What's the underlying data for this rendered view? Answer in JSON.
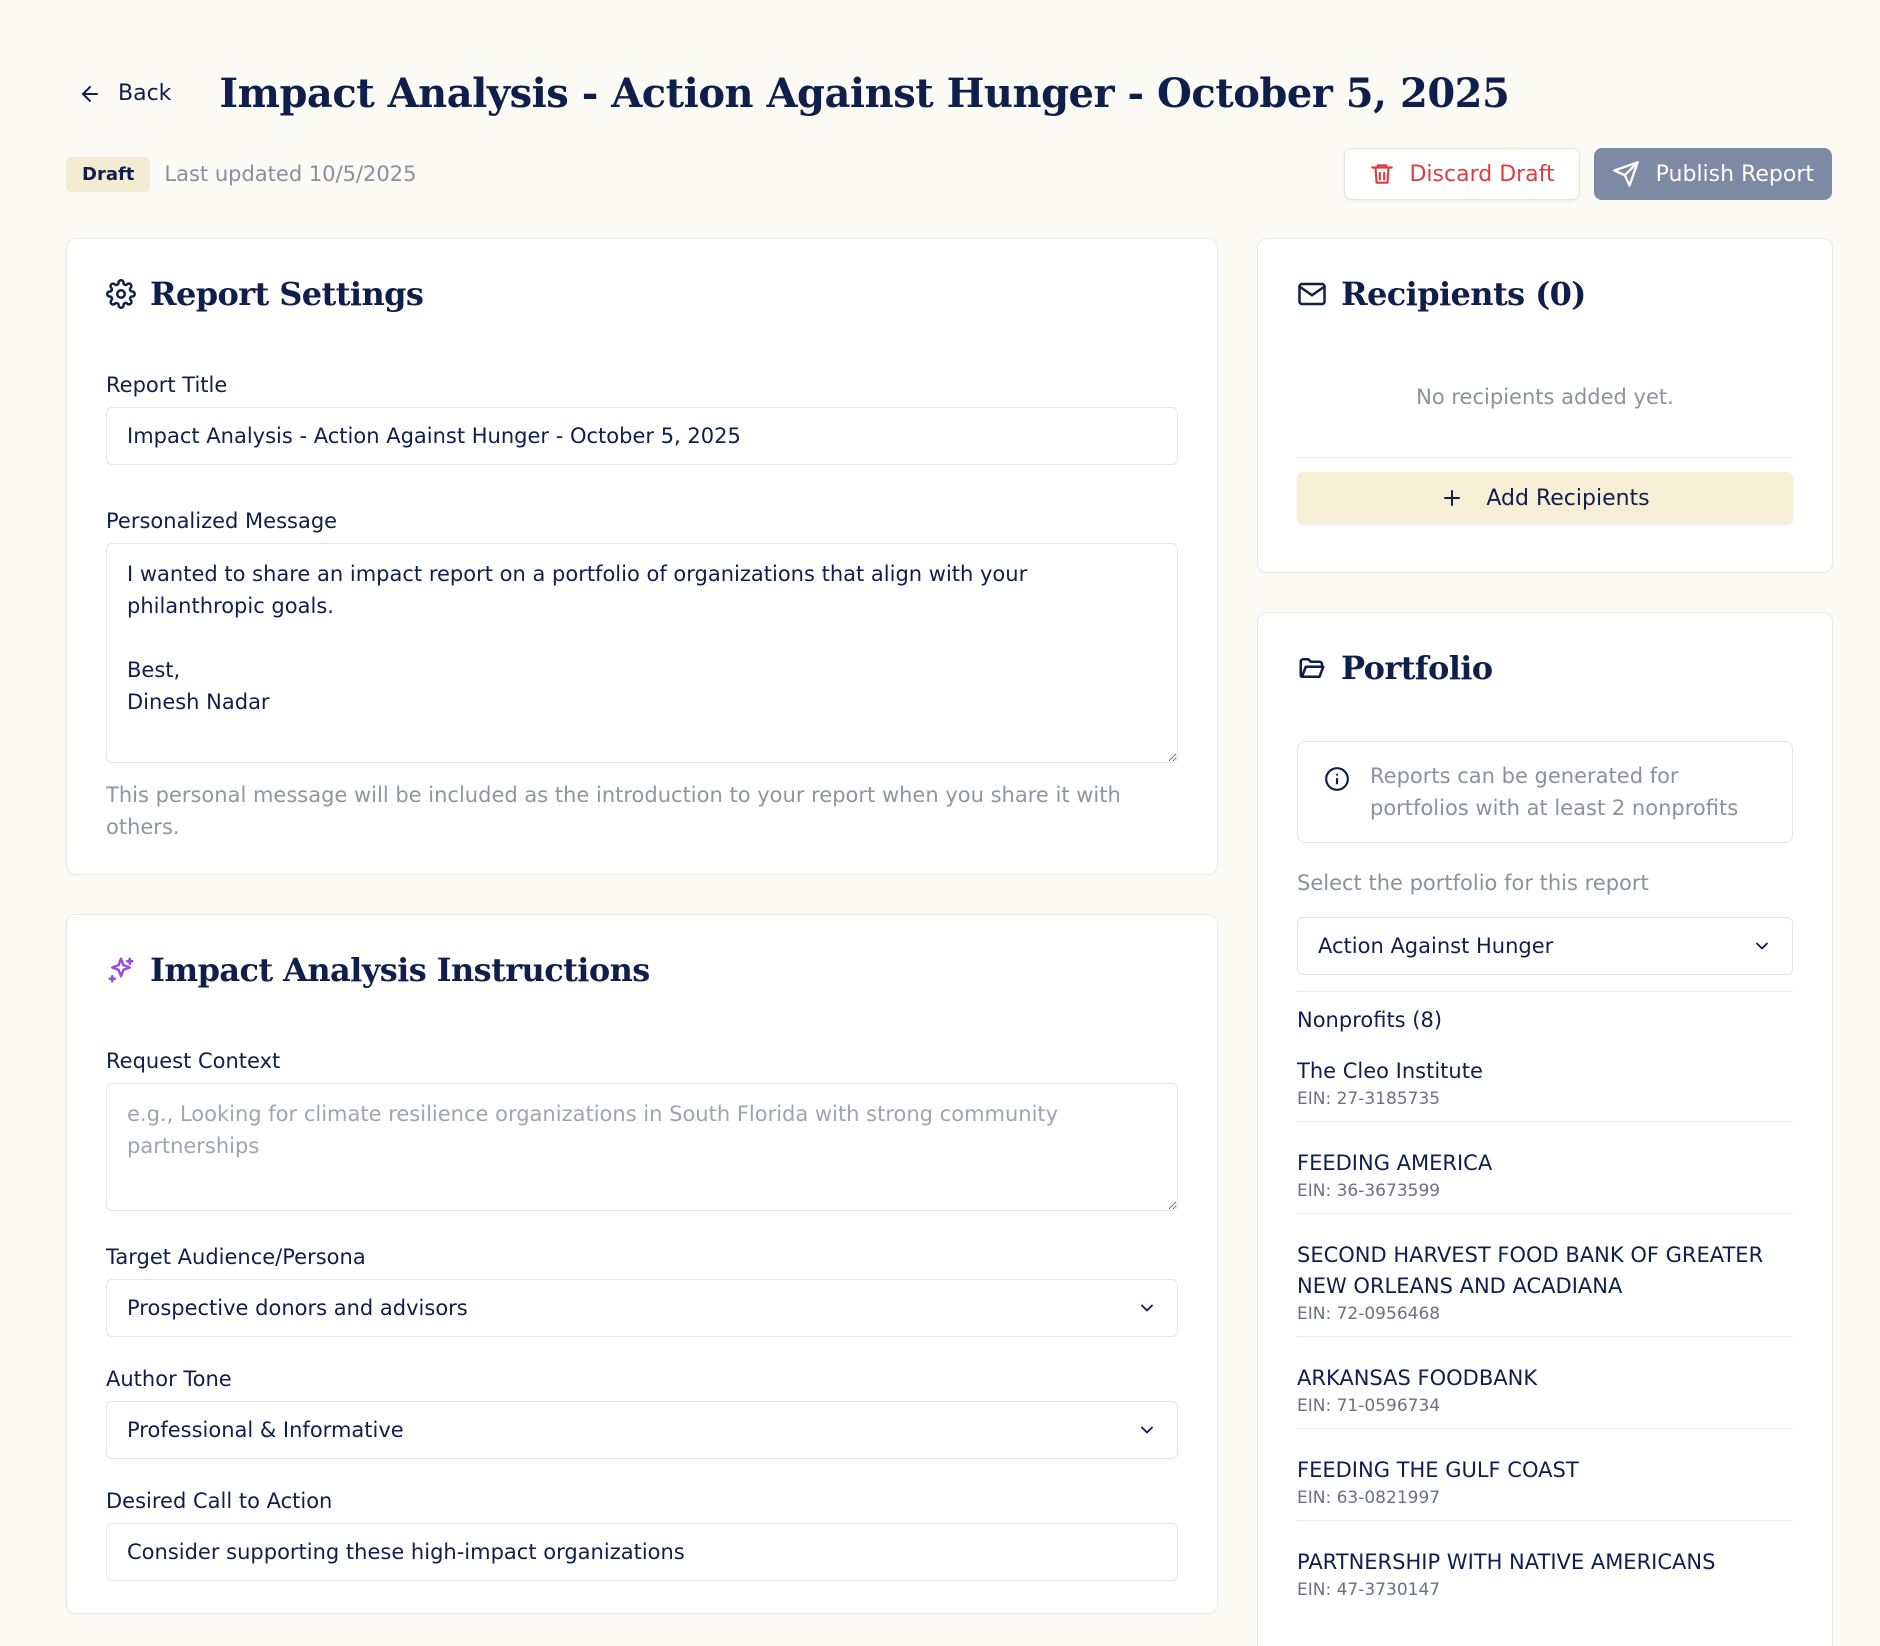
{
  "header": {
    "back_label": "Back",
    "title": "Impact Analysis - Action Against Hunger - October 5, 2025",
    "status_badge": "Draft",
    "last_updated": "Last updated 10/5/2025",
    "discard_label": "Discard Draft",
    "publish_label": "Publish Report"
  },
  "settings": {
    "heading": "Report Settings",
    "title_label": "Report Title",
    "title_value": "Impact Analysis - Action Against Hunger - October 5, 2025",
    "message_label": "Personalized Message",
    "message_value": "I wanted to share an impact report on a portfolio of organizations that align with your philanthropic goals.\n\nBest,\nDinesh Nadar",
    "message_hint": "This personal message will be included as the introduction to your report when you share it with others."
  },
  "instructions": {
    "heading": "Impact Analysis Instructions",
    "context_label": "Request Context",
    "context_placeholder": "e.g., Looking for climate resilience organizations in South Florida with strong community partnerships",
    "audience_label": "Target Audience/Persona",
    "audience_value": "Prospective donors and advisors",
    "tone_label": "Author Tone",
    "tone_value": "Professional & Informative",
    "cta_label": "Desired Call to Action",
    "cta_value": "Consider supporting these high-impact organizations"
  },
  "recipients": {
    "heading": "Recipients (0)",
    "empty_text": "No recipients added yet.",
    "add_label": "Add Recipients"
  },
  "portfolio": {
    "heading": "Portfolio",
    "info_text": "Reports can be generated for portfolios with at least 2 nonprofits",
    "select_label": "Select the portfolio for this report",
    "selected": "Action Against Hunger",
    "nonprofits_heading": "Nonprofits (8)",
    "nonprofits": [
      {
        "name": "The Cleo Institute",
        "ein": "EIN: 27-3185735"
      },
      {
        "name": "FEEDING AMERICA",
        "ein": "EIN: 36-3673599"
      },
      {
        "name": "SECOND HARVEST FOOD BANK OF GREATER NEW ORLEANS AND ACADIANA",
        "ein": "EIN: 72-0956468"
      },
      {
        "name": "ARKANSAS FOODBANK",
        "ein": "EIN: 71-0596734"
      },
      {
        "name": "FEEDING THE GULF COAST",
        "ein": "EIN: 63-0821997"
      },
      {
        "name": "PARTNERSHIP WITH NATIVE AMERICANS",
        "ein": "EIN: 47-3730147"
      }
    ]
  },
  "colors": {
    "primary_text": "#0f1f4b",
    "danger": "#dc3f3f",
    "publish_bg": "#7c8aa3",
    "accent_bg": "#f6efd6",
    "sparkle": "#9b4bd8"
  }
}
